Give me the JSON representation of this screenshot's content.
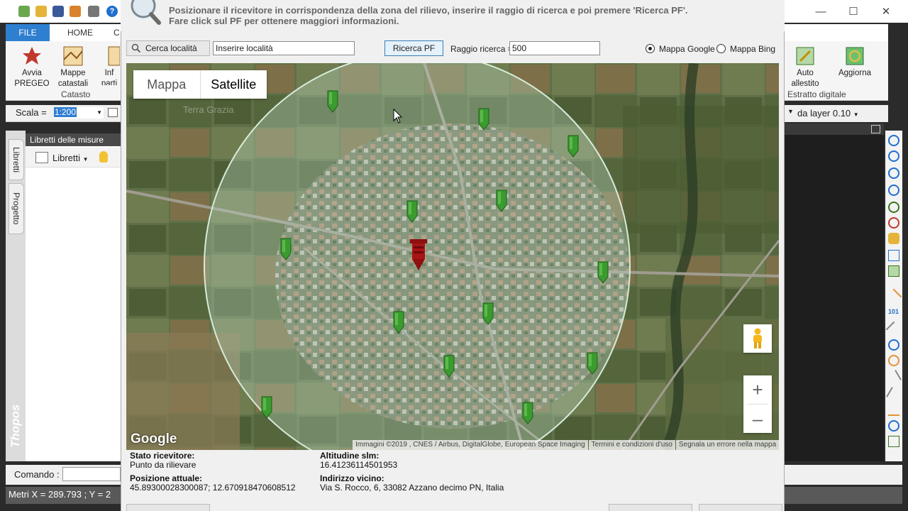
{
  "app": {
    "ribbon_tabs": {
      "file": "FILE",
      "home": "HOME",
      "cut": "C"
    },
    "ribbon_buttons": [
      {
        "label": "Avvia\nPREGEO"
      },
      {
        "label": "Mappe\ncatastali"
      },
      {
        "label": "Inf\nparti"
      }
    ],
    "ribbon_group": "Catasto",
    "scale_label": "Scala =",
    "scale_value": "1:200",
    "panel_title": "Libretti delle misure",
    "libretti_btn": "Libretti",
    "vtab_libretti": "Libretti",
    "vtab_progetto": "Progetto",
    "brand": "Thopos",
    "command_label": "Comando :",
    "status_text": "Metri  X = 289.793 ; Y = 2",
    "right_ribbon": {
      "btn1": "Auto\nallestito",
      "btn2": "Aggiorna",
      "group": "Estratto digitale"
    },
    "layer_value": "da layer 0.10"
  },
  "dialog": {
    "instruction_line1": "Posizionare il ricevitore in corrispondenza della zona del rilievo, inserire il raggio di ricerca e poi premere 'Ricerca PF'.",
    "instruction_line2": "Fare click sul PF per ottenere maggiori informazioni.",
    "search_button": "Cerca località",
    "search_value": "Inserire località",
    "ricerca_button": "Ricerca PF",
    "raggio_label": "Raggio ricerca =",
    "raggio_value": "500",
    "radio_google": "Mappa Google",
    "radio_bing": "Mappa Bing",
    "map": {
      "type_mappa": "Mappa",
      "type_satellite": "Satellite",
      "google_logo": "Google",
      "watermark": "Terra Grazia",
      "attribution": [
        "Immagini ©2019 , CNES / Airbus, DigitalGlobe, European Space Imaging",
        "Termini e condizioni d'uso",
        "Segnala un errore nella mappa"
      ],
      "markers_count_text": ""
    },
    "info": {
      "stato_label": "Stato ricevitore:",
      "stato_value": "Punto da rilievare",
      "altitudine_label": "Altitudine slm:",
      "altitudine_value": "16.41236114501953",
      "posizione_label": "Posizione attuale:",
      "posizione_value": "45.89300028300087; 12.670918470608512",
      "indirizzo_label": "Indirizzo vicino:",
      "indirizzo_value": "Via S. Rocco, 6, 33082 Azzano decimo PN, Italia"
    }
  },
  "colors": {
    "accent": "#2f7fd0",
    "marker_green": "#3a9b2e",
    "receiver_red": "#8e1010",
    "circle_fill": "#b9d8c0"
  }
}
